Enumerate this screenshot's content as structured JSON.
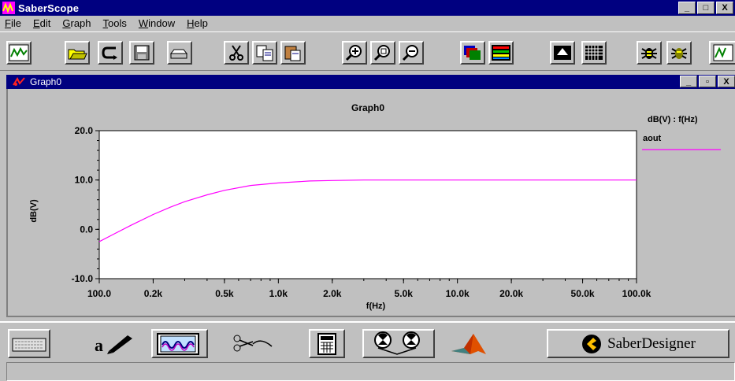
{
  "window": {
    "title": "SaberScope",
    "buttons": [
      "_",
      "□",
      "X"
    ]
  },
  "menu": [
    "File",
    "Edit",
    "Graph",
    "Tools",
    "Window",
    "Help"
  ],
  "toolbar": {
    "icons": [
      "waveform-icon",
      "open-folder-icon",
      "reload-icon",
      "save-icon",
      "print-icon",
      "cut-icon",
      "copy-icon",
      "paste-icon",
      "zoom-in-icon",
      "zoom-fit-icon",
      "zoom-out-icon",
      "color-layers-icon",
      "stacked-colors-icon",
      "fill-icon",
      "grid-icon",
      "bug-icon",
      "bug-alt-icon",
      "signal-icon"
    ]
  },
  "graph_window": {
    "title": "Graph0",
    "buttons": [
      "_",
      "▫",
      "X"
    ]
  },
  "colors": {
    "trace": "#ff00ff",
    "titlebar": "#000080"
  },
  "bottom_tools": {
    "icons": [
      "keyboard-icon",
      "text-pen-icon",
      "scope-icon",
      "scissors-icon",
      "calculator-icon",
      "reels-icon",
      "matlab-icon",
      "saberdesigner-logo-icon"
    ],
    "saber_label": "SaberDesigner"
  },
  "chart_data": {
    "type": "line",
    "title": "Graph0",
    "xlabel": "f(Hz)",
    "ylabel": "dB(V)",
    "xscale": "log",
    "xlim": [
      100,
      100000
    ],
    "ylim": [
      -10,
      20
    ],
    "x_ticks": [
      "100.0",
      "0.2k",
      "0.5k",
      "1.0k",
      "2.0k",
      "5.0k",
      "10.0k",
      "20.0k",
      "50.0k",
      "100.0k"
    ],
    "y_ticks": [
      "20.0",
      "10.0",
      "0.0",
      "-10.0"
    ],
    "legend_header": "dB(V) : f(Hz)",
    "legend_position": "right",
    "series": [
      {
        "name": "aout",
        "x": [
          100,
          120,
          150,
          200,
          250,
          300,
          400,
          500,
          700,
          1000,
          1500,
          2000,
          3000,
          5000,
          10000,
          20000,
          50000,
          100000
        ],
        "y": [
          -2.5,
          -1.0,
          0.8,
          3.0,
          4.5,
          5.6,
          7.0,
          7.9,
          8.9,
          9.4,
          9.8,
          9.9,
          10.0,
          10.0,
          10.0,
          10.0,
          10.0,
          10.0
        ]
      }
    ]
  }
}
